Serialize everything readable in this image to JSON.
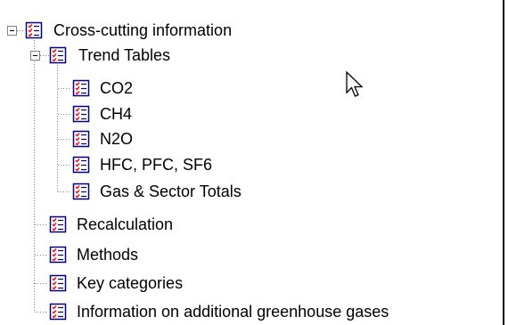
{
  "tree": {
    "root": {
      "label": "Cross-cutting information",
      "expanded": true,
      "icon": "report-list-icon"
    },
    "trend_tables": {
      "label": "Trend Tables",
      "expanded": true,
      "icon": "report-list-icon",
      "children": [
        {
          "label": "CO2",
          "icon": "report-list-icon"
        },
        {
          "label": "CH4",
          "icon": "report-list-icon"
        },
        {
          "label": "N2O",
          "icon": "report-list-icon"
        },
        {
          "label": "HFC, PFC, SF6",
          "icon": "report-list-icon"
        },
        {
          "label": "Gas & Sector Totals",
          "icon": "report-list-icon"
        }
      ]
    },
    "siblings": [
      {
        "label": "Recalculation",
        "icon": "report-list-icon"
      },
      {
        "label": "Methods",
        "icon": "report-list-icon"
      },
      {
        "label": "Key categories",
        "icon": "report-list-icon"
      },
      {
        "label": "Information on additional greenhouse gases",
        "icon": "report-list-icon"
      }
    ]
  },
  "cursor": {
    "icon": "mouse-pointer-icon"
  },
  "colors": {
    "tree_line": "#808080",
    "icon_border": "#000080",
    "icon_check_red": "#ff0000",
    "icon_line_blue": "#000080",
    "frame_border": "#000000"
  }
}
